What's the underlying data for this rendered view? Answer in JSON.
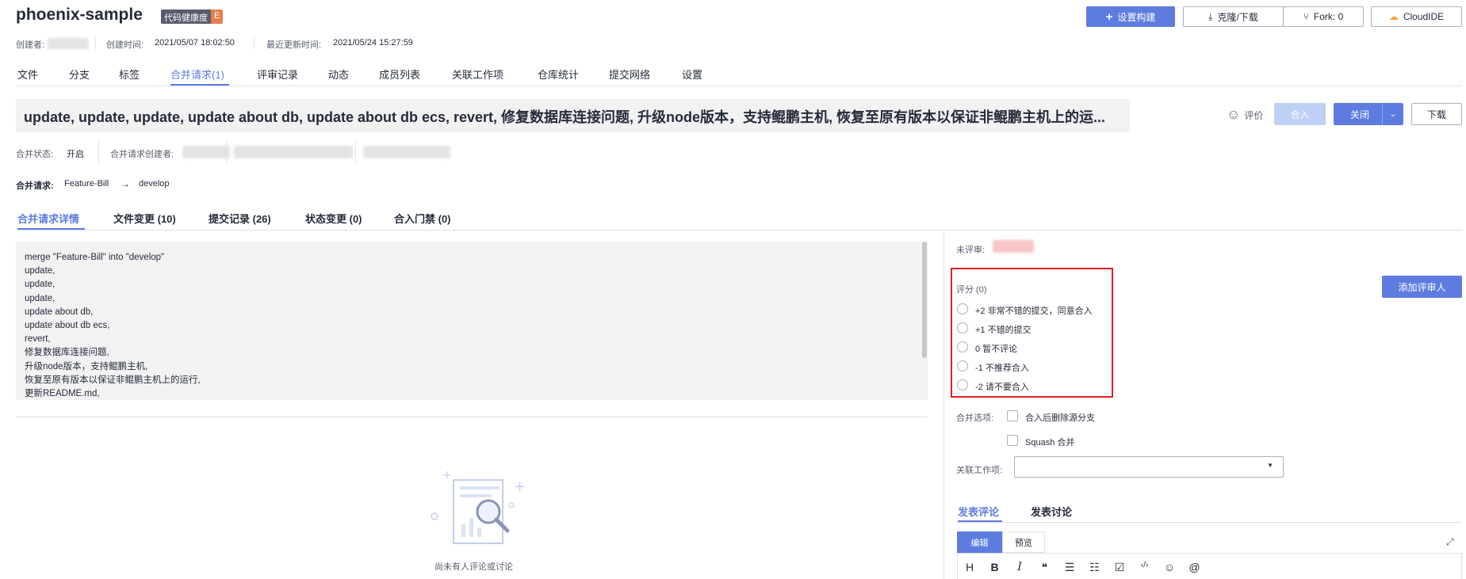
{
  "header": {
    "repo_name": "phoenix-sample",
    "health_label": "代码健康度",
    "health_grade": "E",
    "creator_label": "创建者:",
    "created_label": "创建时间:",
    "created_value": "2021/05/07 18:02:50",
    "updated_label": "最近更新时间:",
    "updated_value": "2021/05/24 15:27:59",
    "buttons": {
      "setup_build": "设置构建",
      "clone_download": "克隆/下载",
      "fork": "Fork: 0",
      "cloudide": "CloudIDE"
    }
  },
  "nav": {
    "tabs": [
      "文件",
      "分支",
      "标签",
      "合并请求(1)",
      "评审记录",
      "动态",
      "成员列表",
      "关联工作项",
      "仓库统计",
      "提交网络",
      "设置"
    ],
    "active_index": 3
  },
  "mr": {
    "title": "update, update, update, update about db, update about db ecs, revert, 修复数据库连接问题, 升级node版本，支持鲲鹏主机, 恢复至原有版本以保证非鲲鹏主机上的运...",
    "rate_label": "评价",
    "merge_button": "合入",
    "close_button": "关闭",
    "download_button": "下载",
    "status_label": "合并状态:",
    "status_value": "开启",
    "creator_label": "合并请求创建者:",
    "request_label": "合并请求:",
    "source_branch": "Feature-Bill",
    "arrow": "→",
    "target_branch": "develop"
  },
  "subtabs": {
    "items": [
      "合并请求详情",
      "文件变更 (10)",
      "提交记录 (26)",
      "状态变更 (0)",
      "合入门禁 (0)"
    ],
    "active_index": 0
  },
  "description": {
    "lines": [
      "merge \"Feature-Bill\" into \"develop\"",
      "update,",
      "update,",
      "update,",
      "update about db,",
      "update about db ecs,",
      "revert,",
      "修复数据库连接问题,",
      "升级node版本，支持鲲鹏主机,",
      "恢复至原有版本以保证非鲲鹏主机上的运行,",
      "更新README.md,"
    ]
  },
  "empty_state": {
    "text": "尚未有人评论或讨论"
  },
  "review": {
    "unreviewed_label": "未评审:",
    "score_title": "评分 (0)",
    "options": [
      "+2 非常不错的提交，同意合入",
      "+1 不错的提交",
      "0 暂不评论",
      "-1 不推荐合入",
      "-2 请不要合入"
    ],
    "add_reviewer_button": "添加评审人",
    "merge_options_label": "合并选项:",
    "delete_branch_label": "合入后删除源分支",
    "squash_label": "Squash 合并",
    "related_work_label": "关联工作项:",
    "related_work_value": ""
  },
  "comment": {
    "tabs": [
      "发表评论",
      "发表讨论"
    ],
    "active_index": 0,
    "edit_tab": "编辑",
    "preview_tab": "预览",
    "toolbar": [
      "H",
      "B",
      "I",
      "❝",
      "☰",
      "☷",
      "☑",
      "‹/›",
      "☺",
      "@"
    ]
  },
  "colors": {
    "brand": "#5e7ce0",
    "highlight_border": "#e02020",
    "health_grade_bg": "#e57d4f"
  }
}
